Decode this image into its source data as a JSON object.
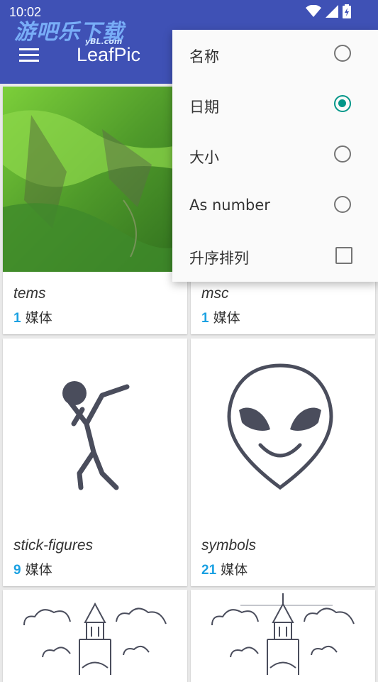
{
  "status_bar": {
    "time": "10:02"
  },
  "watermark": {
    "text": "游吧乐下载",
    "sub": "yBL.com"
  },
  "app_bar": {
    "title": "LeafPic"
  },
  "albums": [
    {
      "name": "tems",
      "count": "1",
      "unit": "媒体",
      "thumb": "green-hills-photo"
    },
    {
      "name": "msc",
      "count": "1",
      "unit": "媒体",
      "thumb": "hidden-photo"
    },
    {
      "name": "stick-figures",
      "count": "9",
      "unit": "媒体",
      "thumb": "stick-figure-icon"
    },
    {
      "name": "symbols",
      "count": "21",
      "unit": "媒体",
      "thumb": "alien-face-icon"
    },
    {
      "thumb": "castle-clouds-drawing"
    },
    {
      "thumb": "castle-clouds-drawing"
    }
  ],
  "sort_menu": {
    "items": [
      {
        "label": "名称",
        "type": "radio",
        "checked": false
      },
      {
        "label": "日期",
        "type": "radio",
        "checked": true
      },
      {
        "label": "大小",
        "type": "radio",
        "checked": false
      },
      {
        "label": "As number",
        "type": "radio",
        "checked": false
      },
      {
        "label": "升序排列",
        "type": "checkbox",
        "checked": false
      }
    ]
  },
  "colors": {
    "appbar": "#3f51b5",
    "accent": "#009688",
    "count": "#1ba1e2",
    "icon_fill": "#4a4d5c"
  }
}
